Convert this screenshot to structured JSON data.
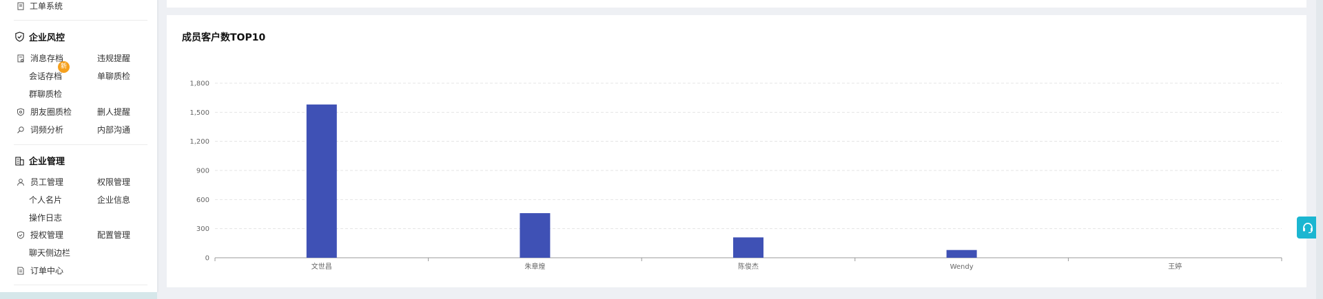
{
  "sidebar": {
    "top_item": {
      "label": "工单系统",
      "icon": "document-icon"
    },
    "risk": {
      "title": "企业风控",
      "icon": "shield-check-icon",
      "items": [
        {
          "label": "消息存档",
          "icon": "archive-icon"
        },
        {
          "label": "违规提醒"
        },
        {
          "label": "会话存档",
          "badge": "新"
        },
        {
          "label": "单聊质检"
        },
        {
          "label": "群聊质检"
        },
        {
          "label": "朋友圈质检",
          "icon": "shield-icon"
        },
        {
          "label": "删人提醒"
        },
        {
          "label": "词频分析",
          "icon": "search-icon"
        },
        {
          "label": "内部沟通"
        }
      ]
    },
    "manage": {
      "title": "企业管理",
      "icon": "building-icon",
      "items": [
        {
          "label": "员工管理",
          "icon": "user-icon"
        },
        {
          "label": "权限管理"
        },
        {
          "label": "个人名片"
        },
        {
          "label": "企业信息"
        },
        {
          "label": "操作日志"
        },
        {
          "label": "授权管理",
          "icon": "shield-icon"
        },
        {
          "label": "配置管理"
        },
        {
          "label": "聊天侧边栏"
        },
        {
          "label": "订单中心",
          "icon": "order-icon"
        }
      ]
    }
  },
  "chart_data": {
    "type": "bar",
    "title": "成员客户数TOP10",
    "categories": [
      "文世昌",
      "朱章煌",
      "陈俊杰",
      "Wendy",
      "王婷"
    ],
    "values": [
      1580,
      460,
      210,
      80,
      0
    ],
    "ylim": [
      0,
      1800
    ],
    "yticks": [
      "0",
      "300",
      "600",
      "900",
      "1,200",
      "1,500",
      "1,800"
    ],
    "ytick_values": [
      0,
      300,
      600,
      900,
      1200,
      1500,
      1800
    ],
    "bar_color": "#3f51b5",
    "grid": true
  },
  "support": {
    "icon": "headset-icon",
    "color": "#1bb6d1"
  }
}
